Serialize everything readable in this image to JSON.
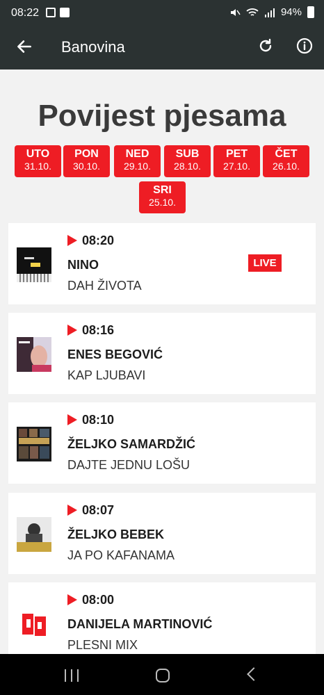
{
  "status_bar": {
    "time": "08:22",
    "battery": "94%"
  },
  "app_bar": {
    "title": "Banovina"
  },
  "page": {
    "heading": "Povijest pjesama"
  },
  "days": [
    {
      "name": "UTO",
      "date": "31.10."
    },
    {
      "name": "PON",
      "date": "30.10."
    },
    {
      "name": "NED",
      "date": "29.10."
    },
    {
      "name": "SUB",
      "date": "28.10."
    },
    {
      "name": "PET",
      "date": "27.10."
    },
    {
      "name": "ČET",
      "date": "26.10."
    },
    {
      "name": "SRI",
      "date": "25.10."
    }
  ],
  "songs": [
    {
      "time": "08:20",
      "artist": "NINO",
      "title": "DAH ŽIVOTA",
      "badge": "LIVE"
    },
    {
      "time": "08:16",
      "artist": "ENES BEGOVIĆ",
      "title": "KAP LJUBAVI"
    },
    {
      "time": "08:10",
      "artist": "ŽELJKO SAMARDŽIĆ",
      "title": "DAJTE JEDNU LOŠU"
    },
    {
      "time": "08:07",
      "artist": "ŽELJKO BEBEK",
      "title": "JA PO KAFANAMA"
    },
    {
      "time": "08:00",
      "artist": "DANIJELA MARTINOVIĆ",
      "title": "PLESNI MIX"
    }
  ],
  "colors": {
    "accent": "#ee1d24",
    "bar": "#2b3232"
  }
}
